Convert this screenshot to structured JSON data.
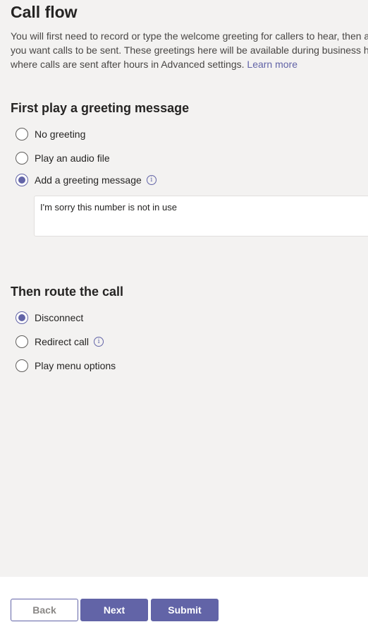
{
  "page": {
    "title": "Call flow",
    "description": [
      "You will first need to record or type the welcome greeting for callers to hear, then a",
      "you want calls to be sent. These greetings here will be available during business ho",
      "where calls are sent after hours in Advanced settings."
    ],
    "learn_more": "Learn more"
  },
  "greeting_section": {
    "title": "First play a greeting message",
    "options": [
      {
        "label": "No greeting",
        "selected": false
      },
      {
        "label": "Play an audio file",
        "selected": false
      },
      {
        "label": "Add a greeting message",
        "selected": true
      }
    ],
    "message_value": "I'm sorry this number is not in use"
  },
  "route_section": {
    "title": "Then route the call",
    "options": [
      {
        "label": "Disconnect",
        "selected": true
      },
      {
        "label": "Redirect call",
        "selected": false
      },
      {
        "label": "Play menu options",
        "selected": false
      }
    ]
  },
  "footer": {
    "back_label": "Back",
    "next_label": "Next",
    "submit_label": "Submit"
  },
  "colors": {
    "accent": "#6264a7",
    "content_bg": "#f3f2f1",
    "text": "#252423"
  }
}
